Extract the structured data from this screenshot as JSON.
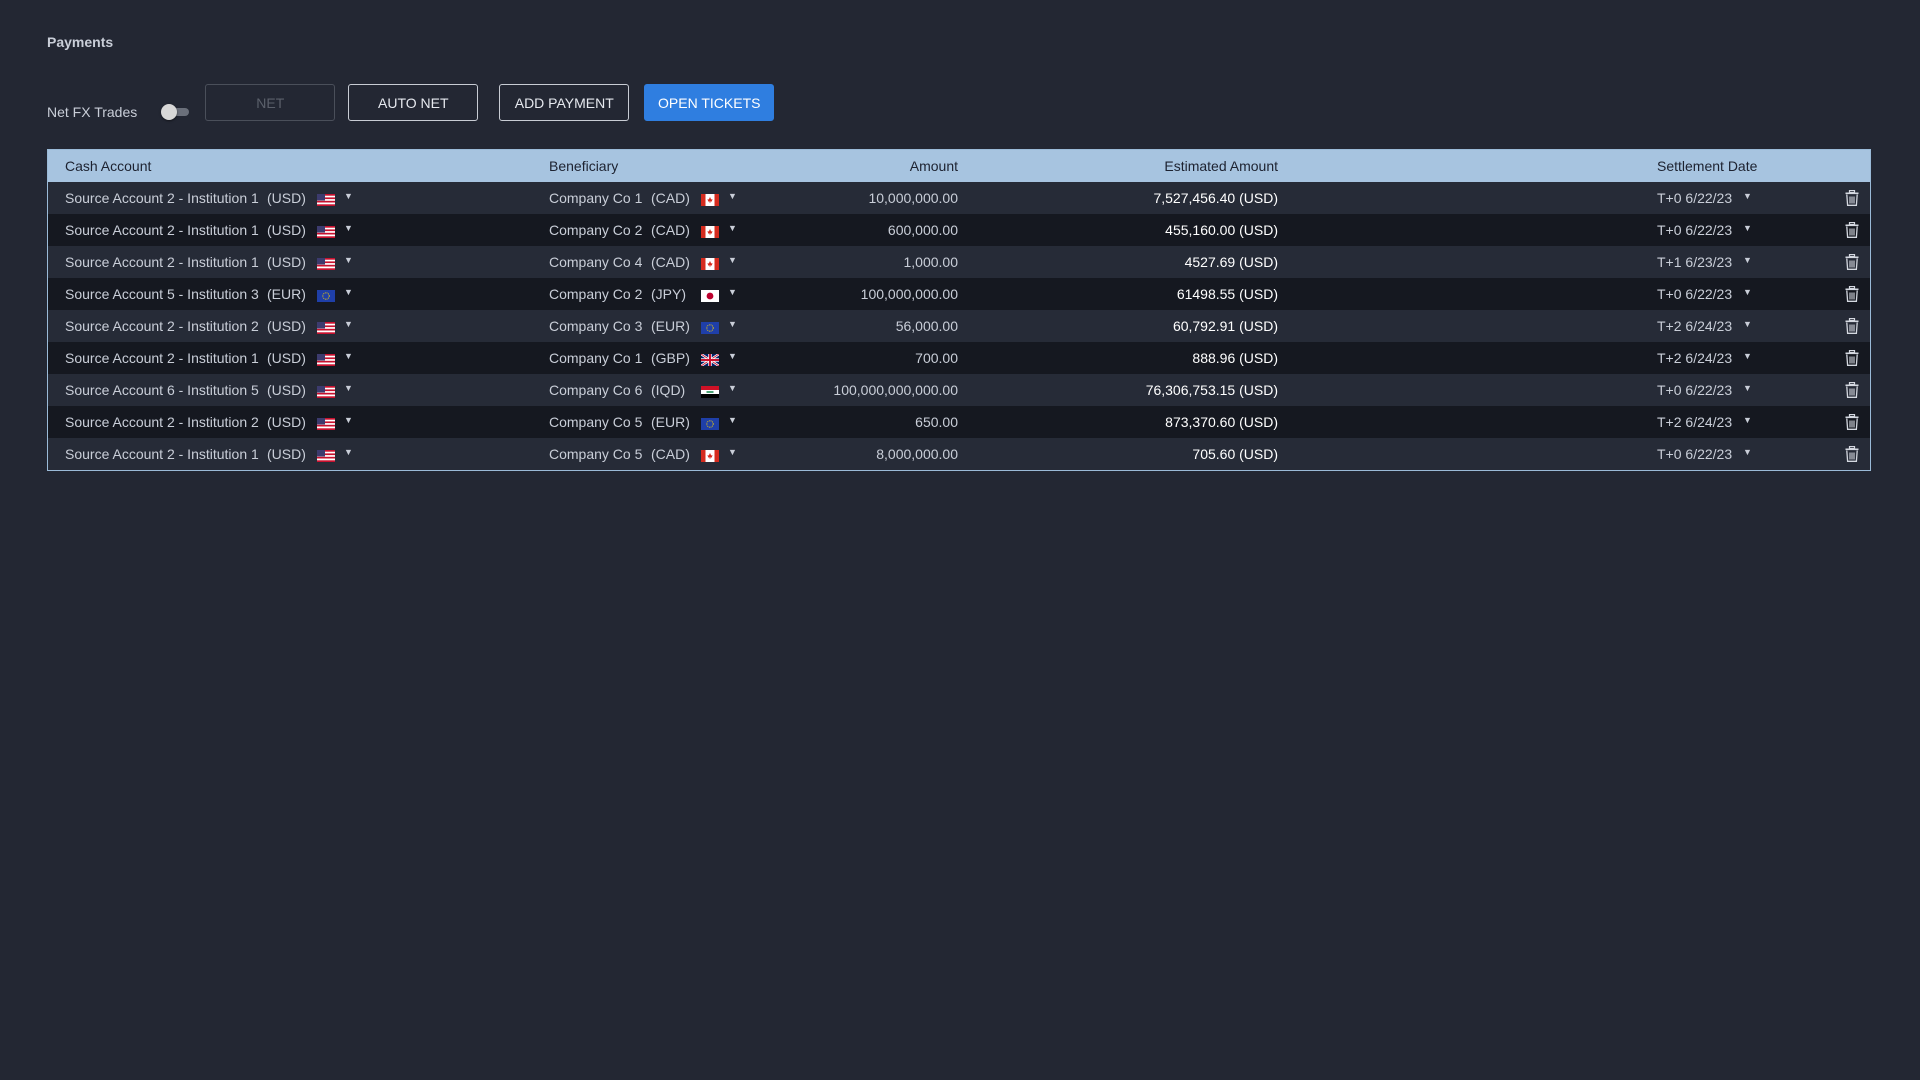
{
  "page": {
    "title": "Payments"
  },
  "toolbar": {
    "net_fx_label": "Net FX Trades",
    "net_fx_enabled": false,
    "net_label": "NET",
    "auto_net_label": "AUTO NET",
    "add_payment_label": "ADD PAYMENT",
    "open_tickets_label": "OPEN TICKETS"
  },
  "colors": {
    "accent": "#2f7ee0",
    "header_bg": "#a7c4e0",
    "background": "#232733"
  },
  "table": {
    "headers": {
      "cash_account": "Cash Account",
      "beneficiary": "Beneficiary",
      "amount": "Amount",
      "estimated_amount": "Estimated Amount",
      "settlement_date": "Settlement Date"
    },
    "rows": [
      {
        "account": "Source Account 2 - Institution 1",
        "account_ccy": "(USD)",
        "account_flag": "us-flag-icon",
        "beneficiary": "Company Co 1",
        "beneficiary_ccy": "(CAD)",
        "beneficiary_flag": "ca-flag-icon",
        "amount": "10,000,000.00",
        "estimated": "7,527,456.40 (USD)",
        "settlement": "T+0 6/22/23"
      },
      {
        "account": "Source Account 2 - Institution 1",
        "account_ccy": "(USD)",
        "account_flag": "us-flag-icon",
        "beneficiary": "Company Co 2",
        "beneficiary_ccy": "(CAD)",
        "beneficiary_flag": "ca-flag-icon",
        "amount": "600,000.00",
        "estimated": "455,160.00  (USD)",
        "settlement": "T+0 6/22/23"
      },
      {
        "account": "Source Account 2 - Institution 1",
        "account_ccy": "(USD)",
        "account_flag": "us-flag-icon",
        "beneficiary": "Company Co 4",
        "beneficiary_ccy": "(CAD)",
        "beneficiary_flag": "ca-flag-icon",
        "amount": "1,000.00",
        "estimated": "4527.69 (USD)",
        "settlement": "T+1 6/23/23"
      },
      {
        "account": "Source Account 5 - Institution 3",
        "account_ccy": "(EUR)",
        "account_flag": "eu-flag-icon",
        "beneficiary": "Company Co 2",
        "beneficiary_ccy": "(JPY)",
        "beneficiary_flag": "jp-flag-icon",
        "amount": "100,000,000.00",
        "estimated": "61498.55 (USD)",
        "settlement": "T+0 6/22/23"
      },
      {
        "account": "Source Account 2 - Institution 2",
        "account_ccy": "(USD)",
        "account_flag": "us-flag-icon",
        "beneficiary": "Company Co 3",
        "beneficiary_ccy": "(EUR)",
        "beneficiary_flag": "eu-flag-icon",
        "amount": "56,000.00",
        "estimated": "60,792.91 (USD)",
        "settlement": "T+2 6/24/23"
      },
      {
        "account": "Source Account 2 - Institution 1",
        "account_ccy": "(USD)",
        "account_flag": "us-flag-icon",
        "beneficiary": "Company Co 1",
        "beneficiary_ccy": "(GBP)",
        "beneficiary_flag": "gb-flag-icon",
        "amount": "700.00",
        "estimated": "888.96 (USD)",
        "settlement": "T+2 6/24/23"
      },
      {
        "account": "Source Account 6 - Institution 5",
        "account_ccy": "(USD)",
        "account_flag": "us-flag-icon",
        "beneficiary": "Company Co 6",
        "beneficiary_ccy": "(IQD)",
        "beneficiary_flag": "iq-flag-icon",
        "amount": "100,000,000,000.00",
        "estimated": "76,306,753.15 (USD)",
        "settlement": "T+0 6/22/23"
      },
      {
        "account": "Source Account 2 - Institution 2",
        "account_ccy": "(USD)",
        "account_flag": "us-flag-icon",
        "beneficiary": "Company Co 5",
        "beneficiary_ccy": "(EUR)",
        "beneficiary_flag": "eu-flag-icon",
        "amount": "650.00",
        "estimated": "873,370.60 (USD)",
        "settlement": "T+2 6/24/23"
      },
      {
        "account": "Source Account 2 - Institution 1",
        "account_ccy": "(USD)",
        "account_flag": "us-flag-icon",
        "beneficiary": "Company Co 5",
        "beneficiary_ccy": "(CAD)",
        "beneficiary_flag": "ca-flag-icon",
        "amount": "8,000,000.00",
        "estimated": "705.60 (USD)",
        "settlement": "T+0 6/22/23"
      }
    ]
  }
}
